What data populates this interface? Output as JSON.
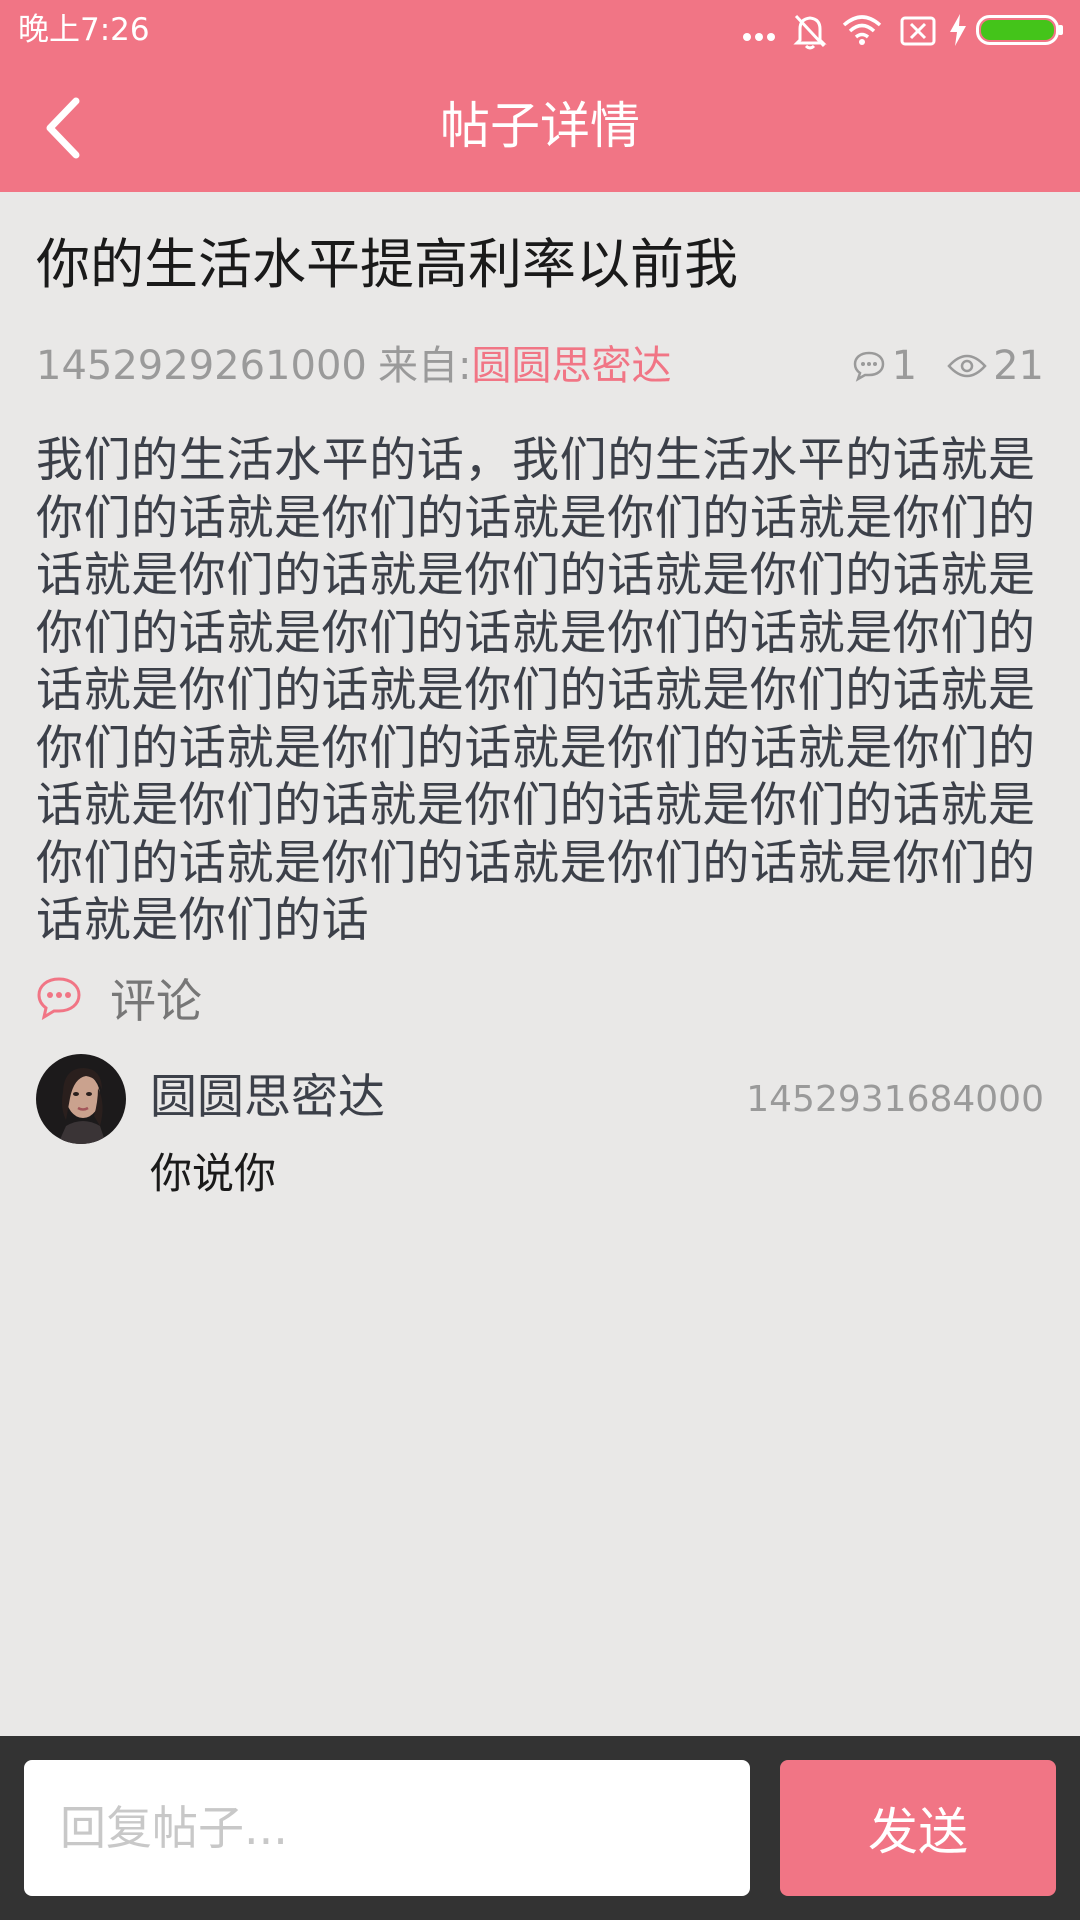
{
  "status_bar": {
    "time": "晚上7:26",
    "icons": [
      "more-dots-icon",
      "bell-off-icon",
      "wifi-icon",
      "no-sim-icon",
      "charging-bolt-icon",
      "battery-icon"
    ]
  },
  "header": {
    "title": "帖子详情",
    "back_icon": "chevron-left-icon"
  },
  "post": {
    "title": "你的生活水平提高利率以前我",
    "timestamp": "1452929261000",
    "from_label": "来自:",
    "author": "圆圆思密达",
    "comment_count": "1",
    "view_count": "21",
    "body": "我们的生活水平的话，我们的生活水平的话就是你们的话就是你们的话就是你们的话就是你们的话就是你们的话就是你们的话就是你们的话就是你们的话就是你们的话就是你们的话就是你们的话就是你们的话就是你们的话就是你们的话就是你们的话就是你们的话就是你们的话就是你们的话就是你们的话就是你们的话就是你们的话就是你们的话就是你们的话就是你们的话就是你们的话就是你们的话"
  },
  "comments": {
    "header_label": "评论",
    "items": [
      {
        "author": "圆圆思密达",
        "timestamp": "1452931684000",
        "text": "你说你"
      }
    ]
  },
  "reply_bar": {
    "placeholder": "回复帖子...",
    "send_label": "发送"
  },
  "colors": {
    "accent": "#f17585",
    "background": "#e9e8e7",
    "bottom_bar": "#333333"
  }
}
